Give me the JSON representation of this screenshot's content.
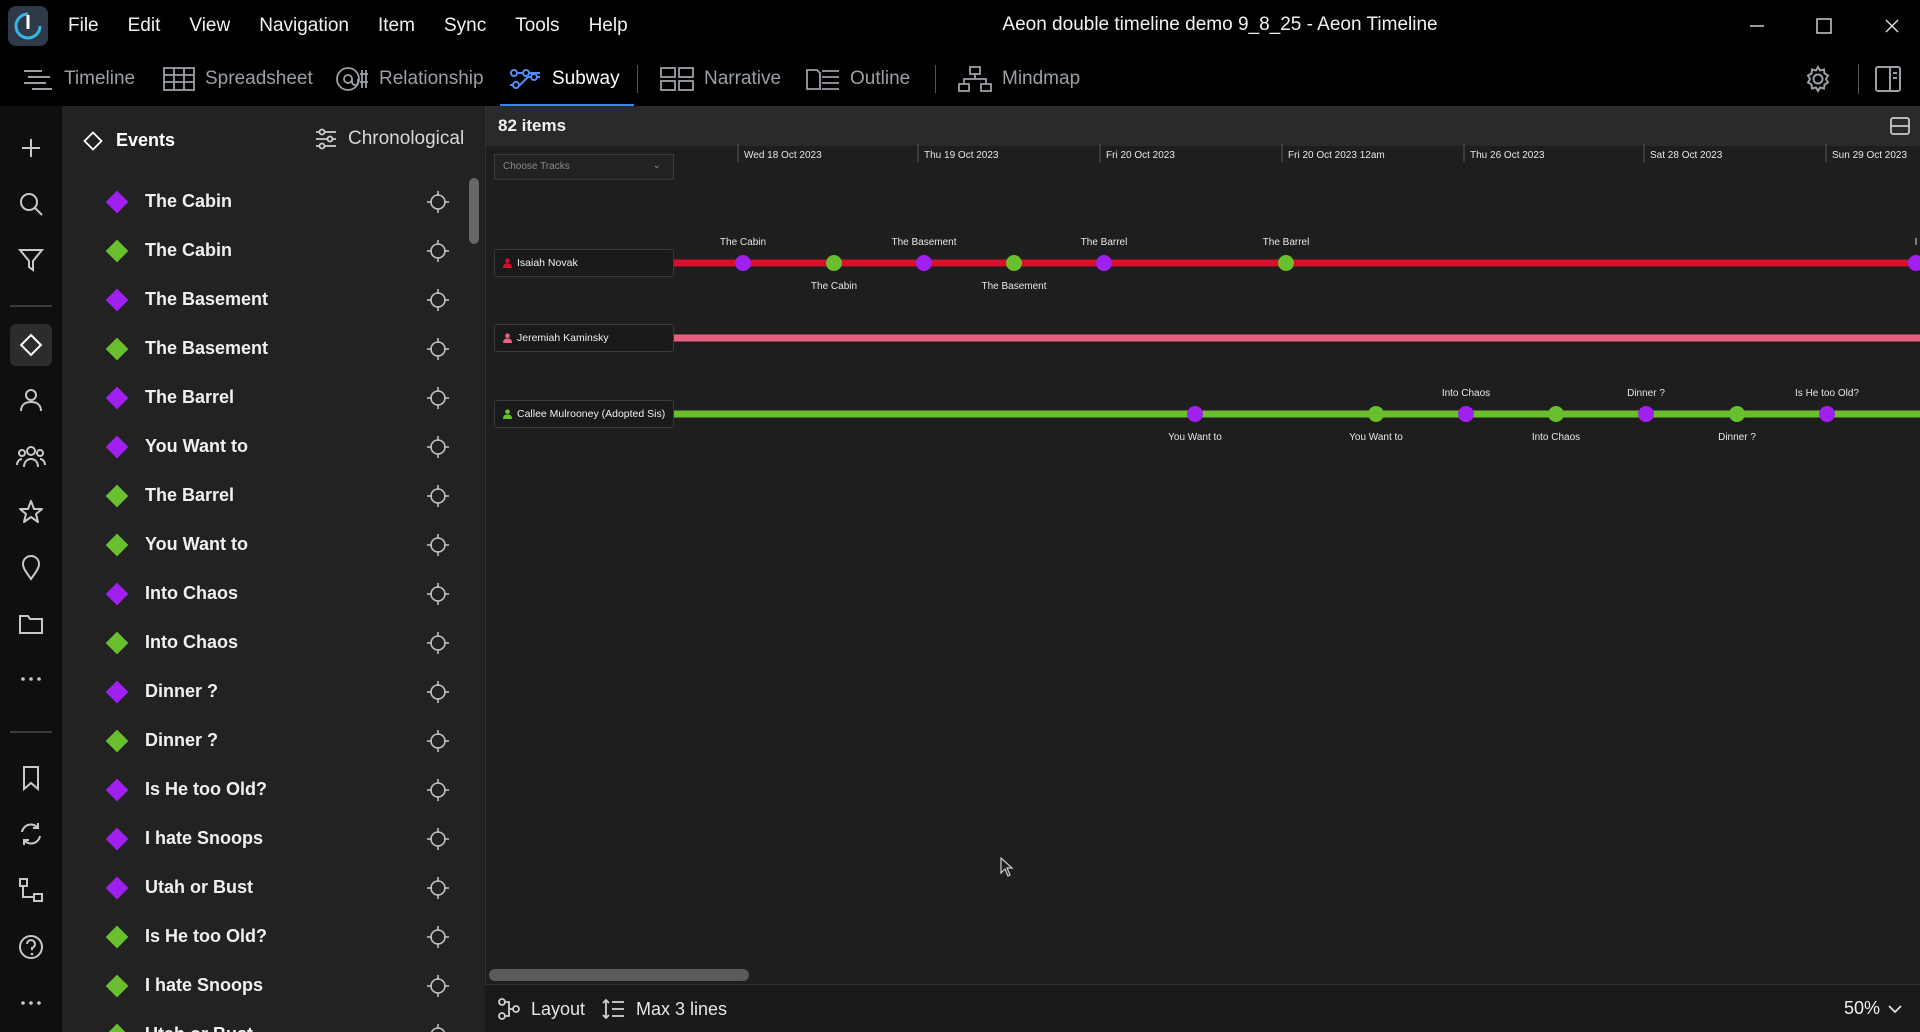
{
  "window": {
    "title": "Aeon double timeline demo 9_8_25 - Aeon Timeline"
  },
  "menu": [
    "File",
    "Edit",
    "View",
    "Navigation",
    "Item",
    "Sync",
    "Tools",
    "Help"
  ],
  "view_tabs": [
    {
      "label": "Timeline",
      "icon": "timeline-icon"
    },
    {
      "label": "Spreadsheet",
      "icon": "spreadsheet-icon"
    },
    {
      "label": "Relationship",
      "icon": "relationship-icon"
    },
    {
      "label": "Subway",
      "icon": "subway-icon",
      "active": true
    },
    {
      "label": "Narrative",
      "icon": "narrative-icon"
    },
    {
      "label": "Outline",
      "icon": "outline-icon"
    },
    {
      "label": "Mindmap",
      "icon": "mindmap-icon"
    }
  ],
  "sidebar": {
    "title": "Events",
    "sort_label": "Chronological",
    "events": [
      {
        "label": "The Cabin",
        "color": "#a020f0"
      },
      {
        "label": "The Cabin",
        "color": "#6abf2e"
      },
      {
        "label": "The Basement",
        "color": "#a020f0"
      },
      {
        "label": "The Basement",
        "color": "#6abf2e"
      },
      {
        "label": "The Barrel",
        "color": "#a020f0"
      },
      {
        "label": "You Want to",
        "color": "#a020f0"
      },
      {
        "label": "The Barrel",
        "color": "#6abf2e"
      },
      {
        "label": "You Want to",
        "color": "#6abf2e"
      },
      {
        "label": "Into Chaos",
        "color": "#a020f0"
      },
      {
        "label": "Into Chaos",
        "color": "#6abf2e"
      },
      {
        "label": "Dinner ?",
        "color": "#a020f0"
      },
      {
        "label": "Dinner ?",
        "color": "#6abf2e"
      },
      {
        "label": "Is He too Old?",
        "color": "#a020f0"
      },
      {
        "label": "I hate Snoops",
        "color": "#a020f0"
      },
      {
        "label": "Utah or Bust",
        "color": "#a020f0"
      },
      {
        "label": "Is He too Old?",
        "color": "#6abf2e"
      },
      {
        "label": "I hate Snoops",
        "color": "#6abf2e"
      },
      {
        "label": "Utah or Bust",
        "color": "#6abf2e"
      }
    ]
  },
  "subway": {
    "items_count": "82 items",
    "choose_tracks_placeholder": "Choose Tracks",
    "date_headers": [
      "Wed 18 Oct 2023",
      "Thu 19 Oct 2023",
      "Fri 20 Oct 2023",
      "Fri 20 Oct 2023 12am",
      "Thu 26 Oct 2023",
      "Sat 28 Oct 2023",
      "Sun 29 Oct 2023"
    ],
    "tracks": [
      {
        "name": "Isaiah Novak",
        "color": "#d4102a",
        "stations": [
          {
            "label": "The Cabin",
            "color": "#a020f0",
            "label_pos": "above"
          },
          {
            "label": "The Cabin",
            "color": "#6abf2e",
            "label_pos": "below"
          },
          {
            "label": "The Basement",
            "color": "#a020f0",
            "label_pos": "above"
          },
          {
            "label": "The Basement",
            "color": "#6abf2e",
            "label_pos": "below"
          },
          {
            "label": "The Barrel",
            "color": "#a020f0",
            "label_pos": "above"
          },
          {
            "label": "The Barrel",
            "color": "#6abf2e",
            "label_pos": "above"
          },
          {
            "label": "I",
            "color": "#a020f0",
            "label_pos": "above"
          }
        ]
      },
      {
        "name": "Jeremiah Kaminsky",
        "color": "#e8607e",
        "stations": []
      },
      {
        "name": "Callee Mulrooney (Adopted Sis)",
        "color": "#6abf2e",
        "stations": [
          {
            "label": "You Want to",
            "color": "#a020f0",
            "label_pos": "below"
          },
          {
            "label": "You Want to",
            "color": "#6abf2e",
            "label_pos": "below"
          },
          {
            "label": "Into Chaos",
            "color": "#a020f0",
            "label_pos": "above"
          },
          {
            "label": "Into Chaos",
            "color": "#6abf2e",
            "label_pos": "below"
          },
          {
            "label": "Dinner ?",
            "color": "#a020f0",
            "label_pos": "above"
          },
          {
            "label": "Dinner ?",
            "color": "#6abf2e",
            "label_pos": "below"
          },
          {
            "label": "Is He too Old?",
            "color": "#a020f0",
            "label_pos": "above"
          }
        ]
      }
    ]
  },
  "bottom_bar": {
    "layout_label": "Layout",
    "lines_label": "Max 3 lines",
    "zoom_label": "50%"
  }
}
